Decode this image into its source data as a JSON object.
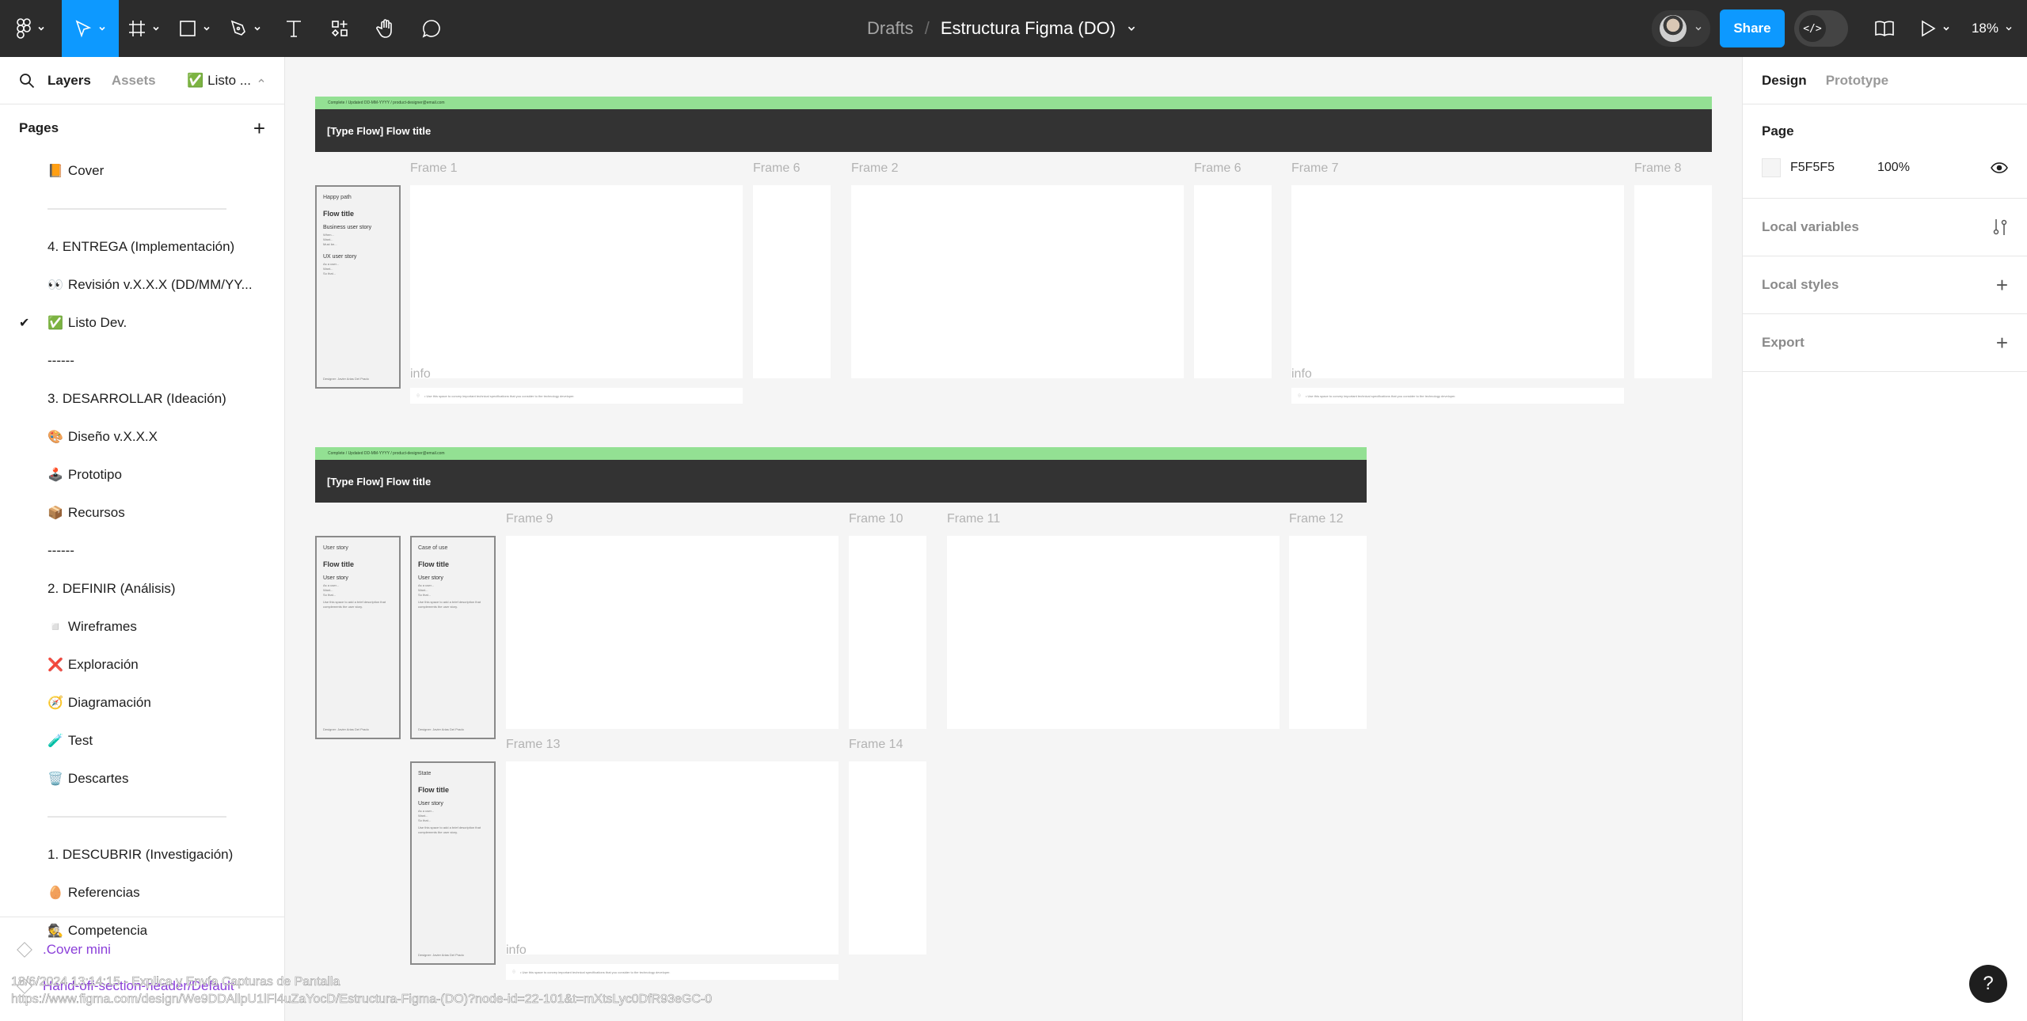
{
  "toolbar": {
    "tools": [
      {
        "name": "main-menu",
        "icon": "figma-logo-icon",
        "has_dropdown": true
      },
      {
        "name": "move",
        "icon": "cursor-icon",
        "has_dropdown": true,
        "active": true
      },
      {
        "name": "frame",
        "icon": "frame-icon",
        "has_dropdown": true
      },
      {
        "name": "shape",
        "icon": "rectangle-icon",
        "has_dropdown": true
      },
      {
        "name": "pen",
        "icon": "pen-icon",
        "has_dropdown": true
      },
      {
        "name": "text",
        "icon": "text-icon",
        "has_dropdown": false
      },
      {
        "name": "resources",
        "icon": "components-icon",
        "has_dropdown": false
      },
      {
        "name": "hand",
        "icon": "hand-icon",
        "has_dropdown": false
      },
      {
        "name": "comment",
        "icon": "comment-icon",
        "has_dropdown": false
      }
    ],
    "breadcrumb": "Drafts",
    "separator": "/",
    "file_name": "Estructura Figma (DO)",
    "share_label": "Share",
    "dev_mode_label": "</>",
    "zoom_level": "18%"
  },
  "left_panel": {
    "tabs": [
      {
        "label": "Layers",
        "active": true
      },
      {
        "label": "Assets",
        "active": false
      }
    ],
    "current_page": "✅ Listo ...",
    "pages_title": "Pages",
    "pages": [
      {
        "emoji": "📙",
        "label": "Cover",
        "type": "page"
      },
      {
        "type": "divider"
      },
      {
        "emoji": "",
        "label": "4. ENTREGA (Implementación)",
        "type": "page"
      },
      {
        "emoji": "👀",
        "label": "Revisión v.X.X.X (DD/MM/YY...",
        "type": "page"
      },
      {
        "emoji": "✅",
        "label": "Listo Dev.",
        "type": "page",
        "selected": true
      },
      {
        "emoji": "",
        "label": "------",
        "type": "page"
      },
      {
        "emoji": "",
        "label": "3. DESARROLLAR (Ideación)",
        "type": "page"
      },
      {
        "emoji": "🎨",
        "label": "Diseño v.X.X.X",
        "type": "page"
      },
      {
        "emoji": "🕹️",
        "label": "Prototipo",
        "type": "page"
      },
      {
        "emoji": "📦",
        "label": "Recursos",
        "type": "page"
      },
      {
        "emoji": "",
        "label": "------",
        "type": "page"
      },
      {
        "emoji": "",
        "label": "2. DEFINIR (Análisis)",
        "type": "page"
      },
      {
        "emoji": "◽",
        "label": "Wireframes",
        "type": "page"
      },
      {
        "emoji": "❌",
        "label": "Exploración",
        "type": "page"
      },
      {
        "emoji": "🧭",
        "label": "Diagramación",
        "type": "page"
      },
      {
        "emoji": "🧪",
        "label": "Test",
        "type": "page"
      },
      {
        "emoji": "🗑️",
        "label": "Descartes",
        "type": "page"
      },
      {
        "type": "divider"
      },
      {
        "emoji": "",
        "label": "1. DESCUBRIR (Investigación)",
        "type": "page"
      },
      {
        "emoji": "🥚",
        "label": "Referencias",
        "type": "page"
      },
      {
        "emoji": "🕵️",
        "label": "Competencia",
        "type": "page"
      }
    ],
    "layers": [
      ".Cover mini",
      "Hand-off-section-header/Default"
    ]
  },
  "right_panel": {
    "tabs": [
      {
        "label": "Design",
        "active": true
      },
      {
        "label": "Prototype",
        "active": false
      }
    ],
    "page_section": {
      "title": "Page",
      "color_hex": "F5F5F5",
      "opacity": "100%"
    },
    "sections": [
      {
        "label": "Local variables",
        "icon": "variables-icon"
      },
      {
        "label": "Local styles",
        "icon": "plus-icon"
      },
      {
        "label": "Export",
        "icon": "plus-icon"
      }
    ]
  },
  "canvas": {
    "flows": [
      {
        "status_line": "Complete / Updated DD-MM-YYYY / product-designer@email.com",
        "title": "[Type Flow] Flow title",
        "cards": [
          {
            "kind": "Happy path",
            "title": "Flow title",
            "sections": [
              {
                "h": "Business user story",
                "lines": [
                  "When...",
                  "Want...",
                  "Must be..."
                ]
              },
              {
                "h": "UX user story",
                "lines": [
                  "As a user...",
                  "Want...",
                  "So that..."
                ]
              }
            ],
            "designer": "Designer: Javier Arias Del Prado"
          }
        ],
        "frames": [
          "Frame 1",
          "Frame 6",
          "Frame 2",
          "Frame 6",
          "Frame 7",
          "Frame 8"
        ]
      },
      {
        "status_line": "Complete / Updated DD-MM-YYYY / product-designer@email.com",
        "title": "[Type Flow] Flow title",
        "cards": [
          {
            "kind": "User story",
            "title": "Flow title",
            "sections": [
              {
                "h": "User story",
                "lines": [
                  "As a user...",
                  "Want...",
                  "So that...",
                  "Use this space to add a brief description that complements the user story."
                ]
              }
            ],
            "designer": "Designer: Javier Arias Del Prado"
          },
          {
            "kind": "Case of use",
            "title": "Flow title",
            "sections": [
              {
                "h": "User story",
                "lines": [
                  "As a user...",
                  "Want...",
                  "So that...",
                  "Use this space to add a brief description that complements the user story."
                ]
              }
            ],
            "designer": "Designer: Javier Arias Del Prado"
          },
          {
            "kind": "State",
            "title": "Flow title",
            "sections": [
              {
                "h": "User story",
                "lines": [
                  "As a user...",
                  "Want...",
                  "So that...",
                  "Use this space to add a brief description that complements the user story."
                ]
              }
            ],
            "designer": "Designer: Javier Arias Del Prado"
          }
        ],
        "frames": [
          "Frame 9",
          "Frame 10",
          "Frame 11",
          "Frame 12",
          "Frame 13",
          "Frame 14"
        ]
      }
    ],
    "info_label": "info",
    "info_text": "• Use this space to convey important technical specifications that you consider to the technology developer."
  },
  "help_label": "?",
  "watermark": {
    "line1": "18/6/2024 13:14:15 - Explica y Envía Capturas de Pantalla",
    "line2": "https://www.figma.com/design/We9DDAllpU1lFl4uZaYocD/Estructura-Figma-(DO)?node-id=22-101&t=mXtsLyc0DfR93eGC-0"
  },
  "colors": {
    "accent": "#0d99ff",
    "toolbar_bg": "#2c2c2c",
    "canvas_bg": "#f5f5f5",
    "status_green": "#93e093",
    "flow_header": "#333333",
    "component_purple": "#8b3fd9"
  }
}
